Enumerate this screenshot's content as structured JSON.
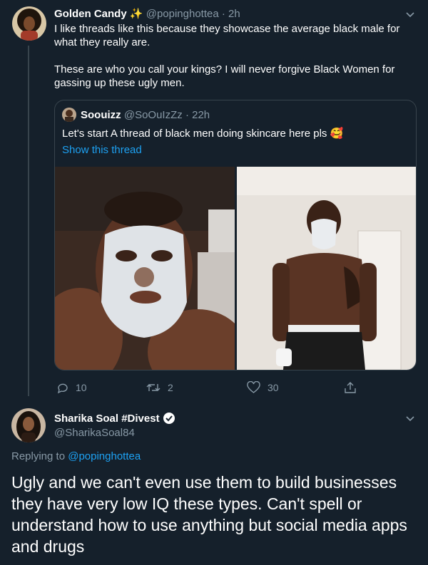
{
  "tweet1": {
    "name": "Golden Candy",
    "name_emoji": "✨",
    "handle": "@popinghottea",
    "time": "· 2h",
    "paragraphs": [
      "I like threads like this because they showcase the average black male for what they really are.",
      "These are who you call your kings? I will never forgive Black Women for gassing up these ugly men."
    ],
    "quote": {
      "name": "Soouizz",
      "handle": "@SoOuIzZz",
      "time": "· 22h",
      "text": "Let's start A thread of black men doing skincare here pls",
      "text_emoji": "🥰",
      "show_thread": "Show this thread"
    },
    "actions": {
      "replies": "10",
      "retweets": "2",
      "likes": "30"
    }
  },
  "tweet2": {
    "name": "Sharika Soal #Divest",
    "handle": "@SharikaSoal84",
    "replying_prefix": "Replying to",
    "replying_to": "@popinghottea",
    "body": "Ugly and we can't even use them to build businesses they have very low IQ these types. Can't spell or understand how to use anything but social media apps and drugs"
  },
  "colors": {
    "background": "#15202b",
    "muted": "#8899a6",
    "link": "#1da1f2",
    "border": "#38444d"
  }
}
